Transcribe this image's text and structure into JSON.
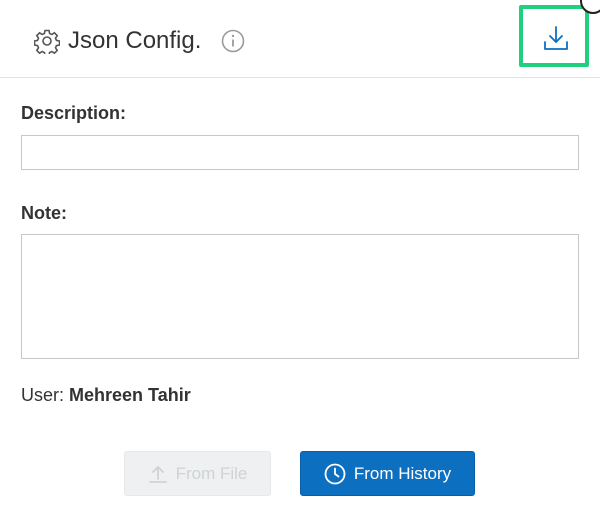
{
  "header": {
    "title": "Json Config.",
    "icons": {
      "settings": "gear-icon",
      "info": "info-icon",
      "download": "download-icon",
      "close": "close-icon"
    }
  },
  "form": {
    "description_label": "Description:",
    "description_value": "",
    "note_label": "Note:",
    "note_value": ""
  },
  "user": {
    "label": "User:",
    "name": "Mehreen Tahir"
  },
  "actions": {
    "from_file_label": "From File",
    "from_history_label": "From History"
  },
  "colors": {
    "highlight": "#1fd07f",
    "primary": "#0d6fbf",
    "disabled_bg": "#eef0f1"
  }
}
